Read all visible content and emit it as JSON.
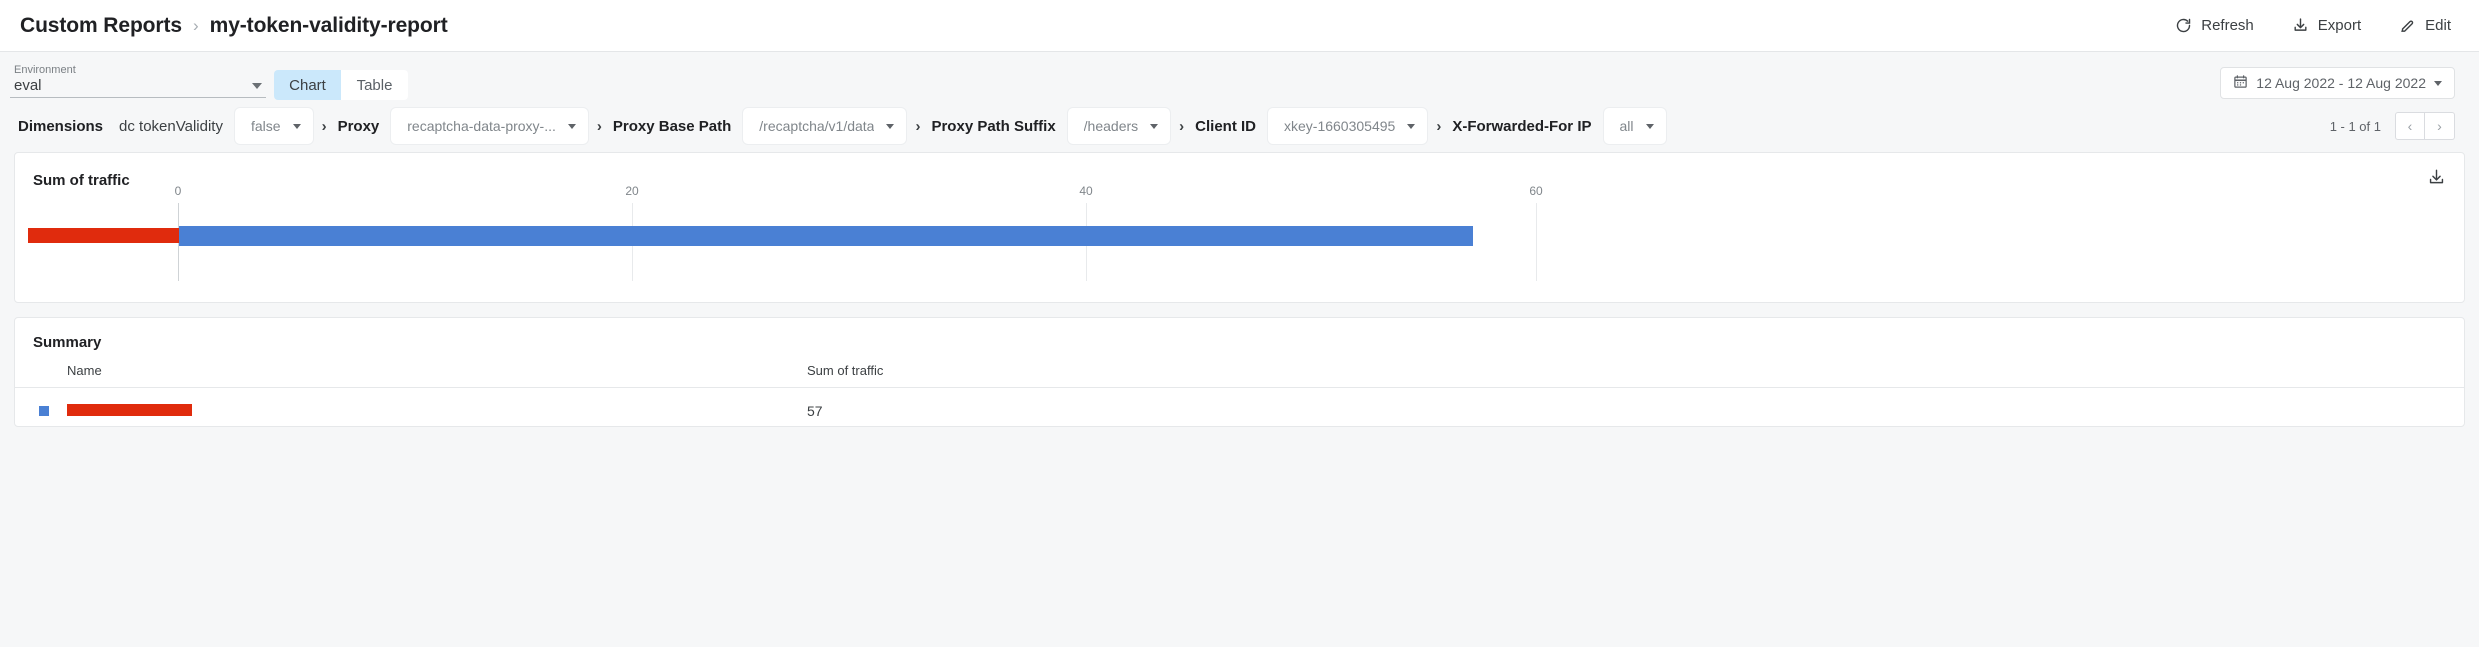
{
  "header": {
    "breadcrumb_root": "Custom Reports",
    "breadcrumb_separator": "›",
    "breadcrumb_current": "my-token-validity-report",
    "actions": [
      {
        "label": "Refresh",
        "icon": "refresh-icon"
      },
      {
        "label": "Export",
        "icon": "download-icon"
      },
      {
        "label": "Edit",
        "icon": "pencil-icon"
      }
    ]
  },
  "controls": {
    "environment_label": "Environment",
    "environment_value": "eval",
    "tabs": [
      {
        "label": "Chart",
        "active": true
      },
      {
        "label": "Table",
        "active": false
      }
    ],
    "date_range": "12 Aug 2022 - 12 Aug 2022",
    "calendar_icon": "calendar-icon"
  },
  "dimensions": {
    "title": "Dimensions",
    "items": [
      {
        "name": "dc tokenValidity",
        "value": "false",
        "bold": false
      },
      {
        "name": "Proxy",
        "value": "recaptcha-data-proxy-...",
        "bold": true
      },
      {
        "name": "Proxy Base Path",
        "value": "/recaptcha/v1/data",
        "bold": true
      },
      {
        "name": "Proxy Path Suffix",
        "value": "/headers",
        "bold": true
      },
      {
        "name": "Client ID",
        "value": "xkey-1660305495",
        "bold": true
      },
      {
        "name": "X-Forwarded-For IP",
        "value": "all",
        "bold": true
      }
    ],
    "pagination": {
      "label": "1 - 1 of 1",
      "prev": "‹",
      "next": "›"
    }
  },
  "chart_card": {
    "title": "Sum of traffic",
    "download_icon": "download-icon"
  },
  "summary_card": {
    "title": "Summary",
    "columns": [
      "Name",
      "Sum of traffic"
    ],
    "rows": [
      {
        "name": "",
        "name_redacted": true,
        "value": "57",
        "swatch_color": "#4a80d4"
      }
    ]
  },
  "chart_data": {
    "type": "bar",
    "orientation": "horizontal",
    "title": "Sum of traffic",
    "categories": [
      ""
    ],
    "category_redacted": true,
    "values": [
      57
    ],
    "series": [
      {
        "name": "Sum of traffic",
        "values": [
          57
        ],
        "color": "#4a80d4"
      }
    ],
    "xlabel": "",
    "ylabel": "",
    "xlim": [
      0,
      60
    ],
    "ticks": [
      0,
      20,
      40,
      60
    ],
    "grid": true,
    "legend_position": "none"
  },
  "colors": {
    "bar_blue": "#4a80d4",
    "redaction_red": "#e02b0d",
    "tab_active_bg": "#cbe8fb",
    "page_bg": "#f6f7f8"
  }
}
